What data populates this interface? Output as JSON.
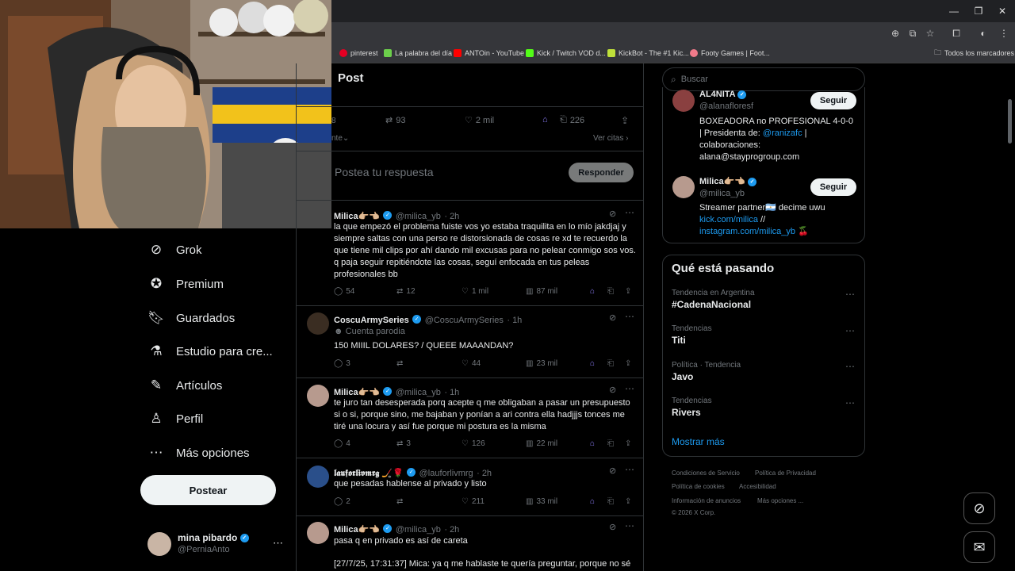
{
  "browser": {
    "bookmarks": [
      "pinterest",
      "La palabra del día",
      "ANTOin - YouTube",
      "Kick / Twitch VOD d...",
      "KickBot - The #1 Kic...",
      "Footy Games | Foot..."
    ],
    "all_bookmarks": "Todos los marcadores"
  },
  "page": {
    "title": "Post",
    "stats": {
      "reposts": "93",
      "likes": "2 mil",
      "bookmarks": "226"
    },
    "sort_fragment": "nte",
    "quotes_link": "Ver citas",
    "reply_placeholder": "Postea tu respuesta",
    "reply_button": "Responder"
  },
  "nav": {
    "items": [
      "Grok",
      "Premium",
      "Guardados",
      "Estudio para cre...",
      "Artículos",
      "Perfil",
      "Más opciones"
    ],
    "post_button": "Postear",
    "user_name": "mina pibardo",
    "user_handle": "@PerniaAnto"
  },
  "tweets": [
    {
      "name": "Milica👉🏼👈🏼",
      "handle": "@milica_yb",
      "time": "· 2h",
      "badge": "",
      "text": "la que empezó el problema fuiste vos yo estaba traquilita en lo mío jakdjaj y siempre saltas con una perso re distorsionada de cosas re xd te recuerdo la que tiene mil clips por ahí dando mil excusas para no pelear conmigo sos vos. q paja seguir repitiéndote las cosas, seguí enfocada en tus peleas profesionales bb",
      "replies": "54",
      "reposts": "12",
      "likes": "1 mil",
      "views": "87 mil"
    },
    {
      "name": "CoscuArmySeries",
      "handle": "@CoscuArmySeries",
      "time": "· 1h",
      "badge": "Cuenta parodia",
      "text": "150 MIIIL DOLARES? / QUEEE MAAANDAN?",
      "replies": "3",
      "reposts": "",
      "likes": "44",
      "views": "23 mil"
    },
    {
      "name": "Milica👉🏼👈🏼",
      "handle": "@milica_yb",
      "time": "· 1h",
      "badge": "",
      "text": "te juro tan desesperada porq acepte q me obligaban a pasar un presupuesto si o si, porque sino, me bajaban y ponían a ari contra ella hadjjjs tonces me tiré una locura y así fue porque mi postura es la misma",
      "replies": "4",
      "reposts": "3",
      "likes": "126",
      "views": "22 mil"
    },
    {
      "name": "𝖑𝖆𝖚𝖋𝖔𝖗𝖑𝖎𝖛𝖒𝖗𝖌 🏒🌹",
      "handle": "@lauforlivmrg",
      "time": "· 2h",
      "badge": "",
      "text": "que pesadas hablense al privado y listo",
      "replies": "2",
      "reposts": "",
      "likes": "211",
      "views": "33 mil"
    },
    {
      "name": "Milica👉🏼👈🏼",
      "handle": "@milica_yb",
      "time": "· 2h",
      "badge": "",
      "text": "pasa q en privado es así de careta",
      "text2": "[27/7/25, 17:31:37] Mica: ya q me hablaste te quería preguntar, porque no sé"
    }
  ],
  "right": {
    "search_placeholder": "Buscar",
    "follow_label": "Seguir",
    "profiles": [
      {
        "name": "AL4NITA",
        "handle": "@alanafloresf",
        "bio_lines": [
          "BOXEADORA no PROFESIONAL 4-0-0",
          "| Presidenta de: ",
          "@ranizafc",
          " |",
          "colaboraciones:",
          "alana@stayprogroup.com"
        ]
      },
      {
        "name": "Milica👉🏼👈🏼",
        "handle": "@milica_yb",
        "bio_lines": [
          "Streamer partner🇦🇷 decime uwu",
          "kick.com/milica",
          " //",
          "instagram.com/milica_yb",
          " 🍒"
        ]
      }
    ],
    "trends_title": "Qué está pasando",
    "trends": [
      {
        "context": "Tendencia en Argentina",
        "name": "#CadenaNacional"
      },
      {
        "context": "Tendencias",
        "name": "Titi"
      },
      {
        "context": "Política · Tendencia",
        "name": "Javo"
      },
      {
        "context": "Tendencias",
        "name": "Rivers"
      }
    ],
    "show_more": "Mostrar más",
    "footer": [
      "Condiciones de Servicio",
      "Política de Privacidad",
      "Política de cookies",
      "Accesibilidad",
      "Información de anuncios",
      "Más opciones ...",
      "© 2026 X Corp."
    ]
  }
}
